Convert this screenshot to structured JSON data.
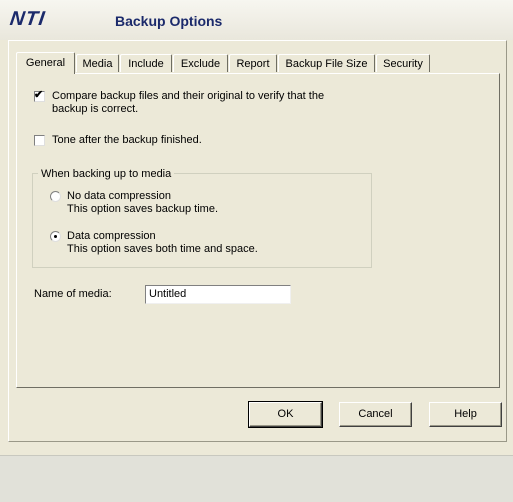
{
  "header": {
    "logo": "NTI",
    "title": "Backup Options"
  },
  "tabs": [
    {
      "label": "General",
      "active": true
    },
    {
      "label": "Media",
      "active": false
    },
    {
      "label": "Include",
      "active": false
    },
    {
      "label": "Exclude",
      "active": false
    },
    {
      "label": "Report",
      "active": false
    },
    {
      "label": "Backup File Size",
      "active": false
    },
    {
      "label": "Security",
      "active": false
    }
  ],
  "general": {
    "compare": {
      "checked": true,
      "line1": "Compare backup files and their original to verify that the",
      "line2": "backup is correct."
    },
    "tone": {
      "checked": false,
      "label": "Tone after the backup finished."
    },
    "media_group": {
      "legend": "When backing up to media",
      "no_compression": {
        "selected": false,
        "label": "No data compression",
        "desc": "This option saves backup time."
      },
      "compression": {
        "selected": true,
        "label": "Data compression",
        "desc": "This option saves both time and space."
      }
    },
    "media_name": {
      "label": "Name of media:",
      "value": "Untitled"
    }
  },
  "buttons": {
    "ok": "OK",
    "cancel": "Cancel",
    "help": "Help"
  }
}
